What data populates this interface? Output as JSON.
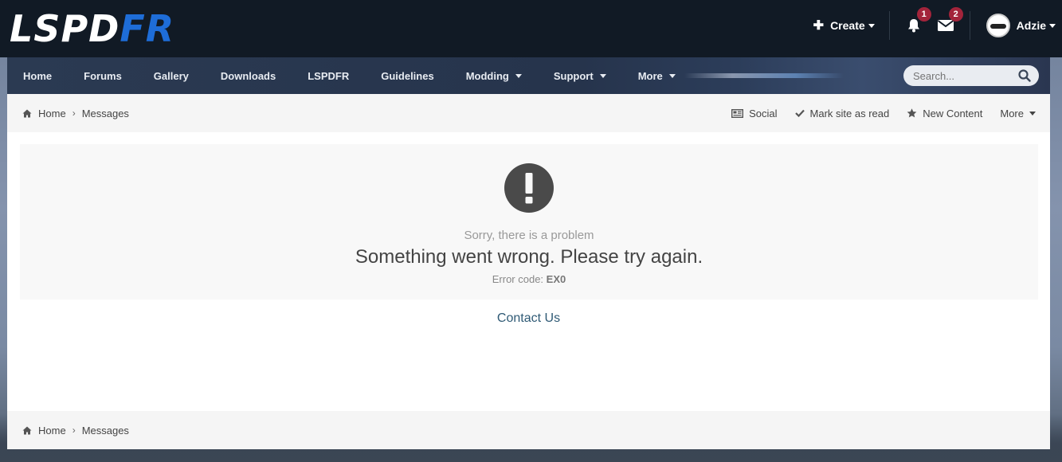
{
  "logo": {
    "part1": "LSPD",
    "part2": "FR"
  },
  "header": {
    "create_label": "Create",
    "notifications_count": "1",
    "messages_count": "2",
    "username": "Adzie"
  },
  "nav": {
    "items": [
      {
        "label": "Home"
      },
      {
        "label": "Forums"
      },
      {
        "label": "Gallery"
      },
      {
        "label": "Downloads"
      },
      {
        "label": "LSPDFR"
      },
      {
        "label": "Guidelines"
      },
      {
        "label": "Modding"
      },
      {
        "label": "Support"
      },
      {
        "label": "More"
      }
    ],
    "search_placeholder": "Search..."
  },
  "breadcrumb": {
    "home": "Home",
    "current": "Messages"
  },
  "actions": {
    "social": "Social",
    "mark_read": "Mark site as read",
    "new_content": "New Content",
    "more": "More"
  },
  "error": {
    "subtitle": "Sorry, there is a problem",
    "message": "Something went wrong. Please try again.",
    "code_label": "Error code:",
    "code": "EX0"
  },
  "contact_label": "Contact Us",
  "colors": {
    "header_bg": "#111a25",
    "accent_blue": "#1e6dd8",
    "badge": "#a3243b",
    "link": "#2f5a75"
  }
}
